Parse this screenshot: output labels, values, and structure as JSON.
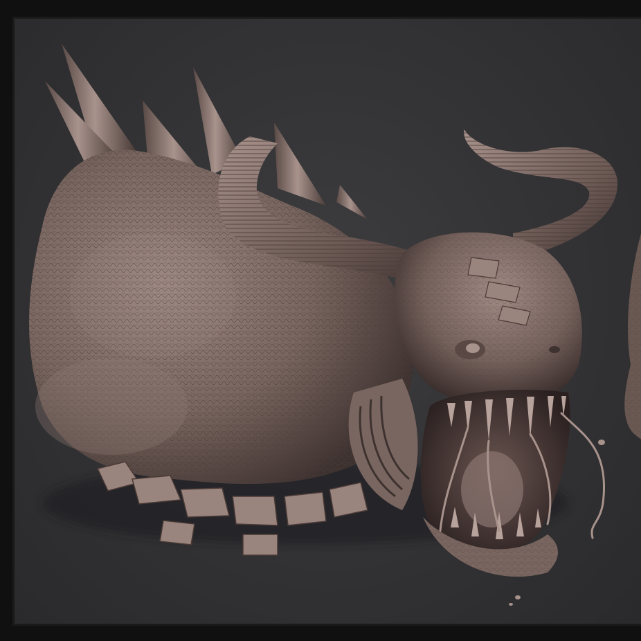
{
  "render": {
    "background_color": "#363638",
    "frame_color": "#101010",
    "sculpt_color": "#8a7570",
    "sculpt_shadow": "#3e3230",
    "sculpt_highlight": "#b8a29c"
  }
}
